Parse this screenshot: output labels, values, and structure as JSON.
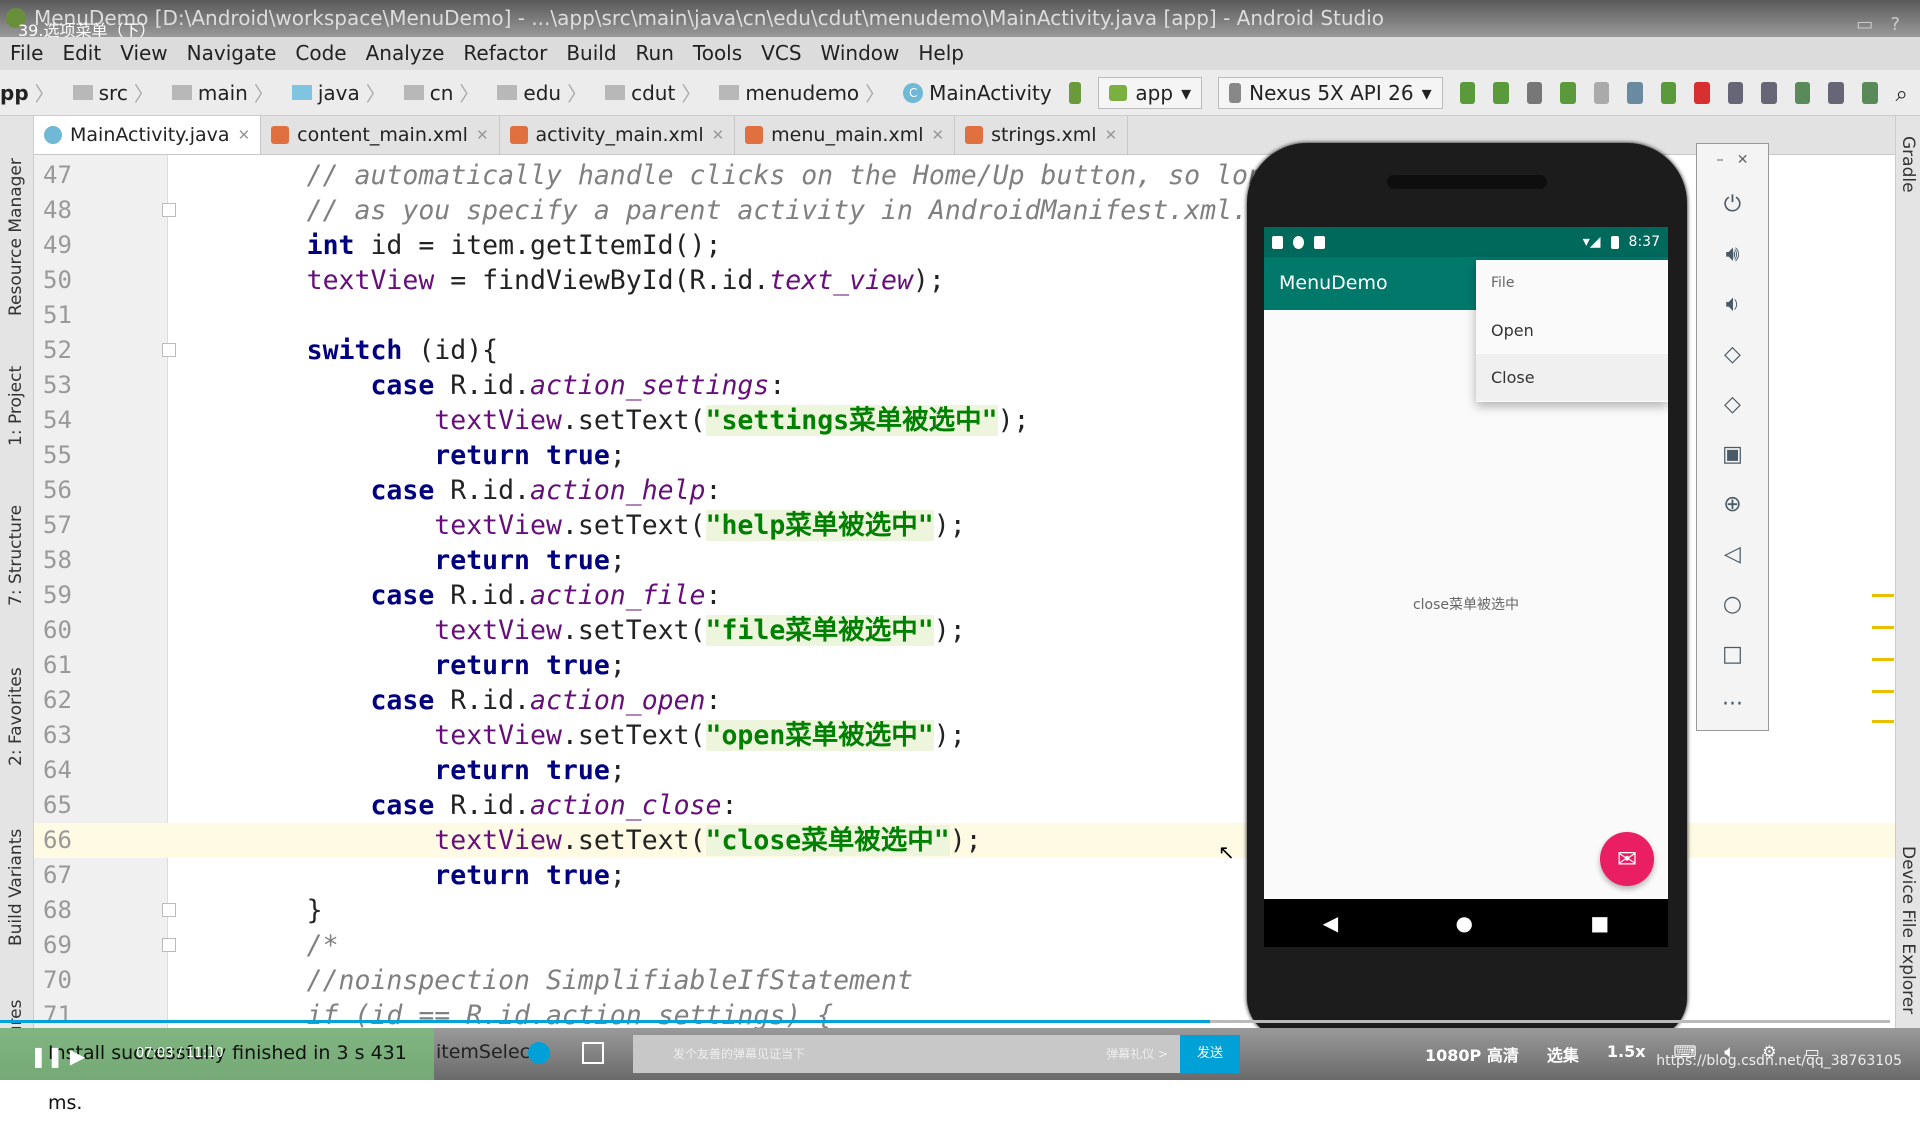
{
  "window": {
    "title": "MenuDemo [D:\\Android\\workspace\\MenuDemo] - ...\\app\\src\\main\\java\\cn\\edu\\cdut\\menudemo\\MainActivity.java [app] - Android Studio",
    "video_title": "39.选项菜单（下）"
  },
  "menu": [
    "File",
    "Edit",
    "View",
    "Navigate",
    "Code",
    "Analyze",
    "Refactor",
    "Build",
    "Run",
    "Tools",
    "VCS",
    "Window",
    "Help"
  ],
  "breadcrumb": [
    "pp",
    "src",
    "main",
    "java",
    "cn",
    "edu",
    "cdut",
    "menudemo",
    "MainActivity"
  ],
  "toolbar": {
    "run_config": "app",
    "device": "Nexus 5X API 26"
  },
  "tabs": [
    {
      "label": "MainActivity.java",
      "active": true
    },
    {
      "label": "content_main.xml"
    },
    {
      "label": "activity_main.xml"
    },
    {
      "label": "menu_main.xml"
    },
    {
      "label": "strings.xml"
    }
  ],
  "left_tools": [
    "Resource Manager",
    "1: Project",
    "7: Structure",
    "2: Favorites",
    "Build Variants",
    "Captures"
  ],
  "right_tools": [
    "Gradle",
    "Device File Explorer"
  ],
  "code": [
    {
      "n": "47",
      "tok": [
        [
          "        ",
          ""
        ],
        [
          "// automatically handle clicks on the Home/Up button, so lon",
          "cm"
        ]
      ]
    },
    {
      "n": "48",
      "tok": [
        [
          "        ",
          ""
        ],
        [
          "// as you specify a parent activity in AndroidManifest.xml.",
          "cm"
        ]
      ]
    },
    {
      "n": "49",
      "tok": [
        [
          "        ",
          ""
        ],
        [
          "int",
          "kw"
        ],
        [
          " id = item.getItemId();",
          ""
        ]
      ]
    },
    {
      "n": "50",
      "tok": [
        [
          "        ",
          ""
        ],
        [
          "textView",
          "fld"
        ],
        [
          " = findViewById(R.id.",
          ""
        ],
        [
          "text_view",
          "idf"
        ],
        [
          ");",
          ""
        ]
      ]
    },
    {
      "n": "51",
      "tok": []
    },
    {
      "n": "52",
      "tok": [
        [
          "        ",
          ""
        ],
        [
          "switch",
          "kw"
        ],
        [
          " (id){",
          ""
        ]
      ]
    },
    {
      "n": "53",
      "tok": [
        [
          "            ",
          ""
        ],
        [
          "case",
          "kw"
        ],
        [
          " R.id.",
          ""
        ],
        [
          "action_settings",
          "idf"
        ],
        [
          ":",
          ""
        ]
      ]
    },
    {
      "n": "54",
      "tok": [
        [
          "                ",
          ""
        ],
        [
          "textView",
          "fld"
        ],
        [
          ".setText(",
          ""
        ],
        [
          "\"settings菜单被选中\"",
          "str"
        ],
        [
          ");",
          ""
        ]
      ]
    },
    {
      "n": "55",
      "tok": [
        [
          "                ",
          ""
        ],
        [
          "return true",
          "kw"
        ],
        [
          ";",
          ""
        ]
      ]
    },
    {
      "n": "56",
      "tok": [
        [
          "            ",
          ""
        ],
        [
          "case",
          "kw"
        ],
        [
          " R.id.",
          ""
        ],
        [
          "action_help",
          "idf"
        ],
        [
          ":",
          ""
        ]
      ]
    },
    {
      "n": "57",
      "tok": [
        [
          "                ",
          ""
        ],
        [
          "textView",
          "fld"
        ],
        [
          ".setText(",
          ""
        ],
        [
          "\"help菜单被选中\"",
          "str"
        ],
        [
          ");",
          ""
        ]
      ]
    },
    {
      "n": "58",
      "tok": [
        [
          "                ",
          ""
        ],
        [
          "return true",
          "kw"
        ],
        [
          ";",
          ""
        ]
      ]
    },
    {
      "n": "59",
      "tok": [
        [
          "            ",
          ""
        ],
        [
          "case",
          "kw"
        ],
        [
          " R.id.",
          ""
        ],
        [
          "action_file",
          "idf"
        ],
        [
          ":",
          ""
        ]
      ]
    },
    {
      "n": "60",
      "tok": [
        [
          "                ",
          ""
        ],
        [
          "textView",
          "fld"
        ],
        [
          ".setText(",
          ""
        ],
        [
          "\"file菜单被选中\"",
          "str"
        ],
        [
          ");",
          ""
        ]
      ]
    },
    {
      "n": "61",
      "tok": [
        [
          "                ",
          ""
        ],
        [
          "return true",
          "kw"
        ],
        [
          ";",
          ""
        ]
      ]
    },
    {
      "n": "62",
      "tok": [
        [
          "            ",
          ""
        ],
        [
          "case",
          "kw"
        ],
        [
          " R.id.",
          ""
        ],
        [
          "action_open",
          "idf"
        ],
        [
          ":",
          ""
        ]
      ]
    },
    {
      "n": "63",
      "tok": [
        [
          "                ",
          ""
        ],
        [
          "textView",
          "fld"
        ],
        [
          ".setText(",
          ""
        ],
        [
          "\"open菜单被选中\"",
          "str"
        ],
        [
          ");",
          ""
        ]
      ]
    },
    {
      "n": "64",
      "tok": [
        [
          "                ",
          ""
        ],
        [
          "return true",
          "kw"
        ],
        [
          ";",
          ""
        ]
      ]
    },
    {
      "n": "65",
      "tok": [
        [
          "            ",
          ""
        ],
        [
          "case",
          "kw"
        ],
        [
          " R.id.",
          ""
        ],
        [
          "action_close",
          "idf"
        ],
        [
          ":",
          ""
        ]
      ]
    },
    {
      "n": "66",
      "tok": [
        [
          "                ",
          ""
        ],
        [
          "textView",
          "fld"
        ],
        [
          ".setText(",
          ""
        ],
        [
          "\"close菜单被选中\"",
          "str"
        ],
        [
          ");",
          ""
        ]
      ],
      "current": true
    },
    {
      "n": "67",
      "tok": [
        [
          "                ",
          ""
        ],
        [
          "return true",
          "kw"
        ],
        [
          ";",
          ""
        ]
      ]
    },
    {
      "n": "68",
      "tok": [
        [
          "        }",
          ""
        ]
      ]
    },
    {
      "n": "69",
      "tok": [
        [
          "        ",
          ""
        ],
        [
          "/*",
          "cm"
        ]
      ]
    },
    {
      "n": "70",
      "tok": [
        [
          "        ",
          ""
        ],
        [
          "//noinspection SimplifiableIfStatement",
          "cm"
        ]
      ]
    },
    {
      "n": "71",
      "tok": [
        [
          "        ",
          ""
        ],
        [
          "if (id == R.id.action_settings) {",
          "cm"
        ]
      ]
    }
  ],
  "phone": {
    "time": "8:37",
    "app_title": "MenuDemo",
    "menu_items": [
      "File",
      "Open",
      "Close"
    ],
    "message": "close菜单被选中",
    "accent": "#00796b",
    "fab_color": "#e91e63"
  },
  "player": {
    "install_msg": "Install successfully finished in 3 s 431 ms.",
    "time": "07:03 / 11:10",
    "partial_text": "itemSelect",
    "danmu_placeholder": "发个友善的弹幕见证当下",
    "danmu_etiquette": "弹幕礼仪 >",
    "send": "发送",
    "quality": "1080P 高清",
    "episodes": "选集",
    "speed": "1.5x",
    "watermark": "https://blog.csdn.net/qq_38763105"
  }
}
